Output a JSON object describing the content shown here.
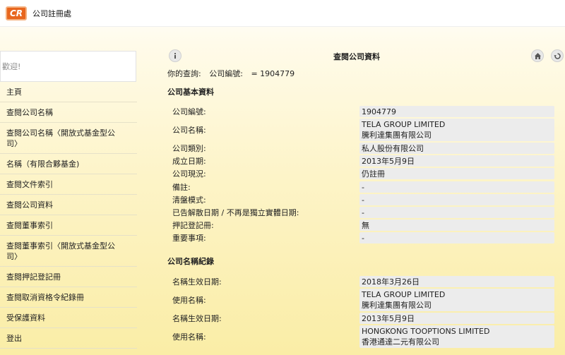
{
  "app": {
    "logo_text": "CR",
    "title": "公司註冊處"
  },
  "sidebar": {
    "search_placeholder": "歡迎!",
    "items": [
      "主頁",
      "查閱公司名稱",
      "查閱公司名稱〈開放式基金型公司〉",
      "名稱（有限合夥基金)",
      "查閱文件索引",
      "查閱公司資料",
      "查閱董事索引",
      "查閱董事索引〈開放式基金型公司〉",
      "查閱押記登記冊",
      "查閱取消資格令紀錄冊",
      "受保護資料",
      "登出"
    ]
  },
  "main": {
    "title": "查閱公司資料",
    "icons": {
      "info": "info-icon",
      "home": "home-icon",
      "back": "back-icon"
    },
    "query": {
      "label": "你的查詢:",
      "field": "公司編號:",
      "value": "= 1904779"
    },
    "basic_section": {
      "title": "公司基本資料",
      "rows": [
        {
          "label": "公司編號:",
          "value": [
            "1904779"
          ]
        },
        {
          "label": "公司名稱:",
          "value": [
            "TELA GROUP LIMITED",
            "騰利達集團有限公司"
          ]
        },
        {
          "label": "公司類別:",
          "value": [
            "私人股份有限公司"
          ]
        },
        {
          "label": "成立日期:",
          "value": [
            "2013年5月9日"
          ]
        },
        {
          "label": "公司現況:",
          "value": [
            "仍註冊"
          ]
        },
        {
          "label": "備註:",
          "value": [
            "-"
          ]
        },
        {
          "label": "清盤模式:",
          "value": [
            "-"
          ]
        },
        {
          "label": "已告解散日期 / 不再是獨立實體日期:",
          "value": [
            "-"
          ]
        },
        {
          "label": "押記登記冊:",
          "value": [
            "無"
          ]
        },
        {
          "label": "重要事項:",
          "value": [
            "-"
          ]
        }
      ]
    },
    "name_section": {
      "title": "公司名稱紀錄",
      "rows": [
        {
          "label": "名稱生效日期:",
          "value": [
            "2018年3月26日"
          ]
        },
        {
          "label": "使用名稱:",
          "value": [
            "TELA GROUP LIMITED",
            "騰利達集團有限公司"
          ]
        },
        {
          "label": "名稱生效日期:",
          "value": [
            "2013年5月9日"
          ]
        },
        {
          "label": "使用名稱:",
          "value": [
            "HONGKONG TOOPTIONS LIMITED",
            "香港通達二元有限公司"
          ]
        }
      ]
    }
  }
}
